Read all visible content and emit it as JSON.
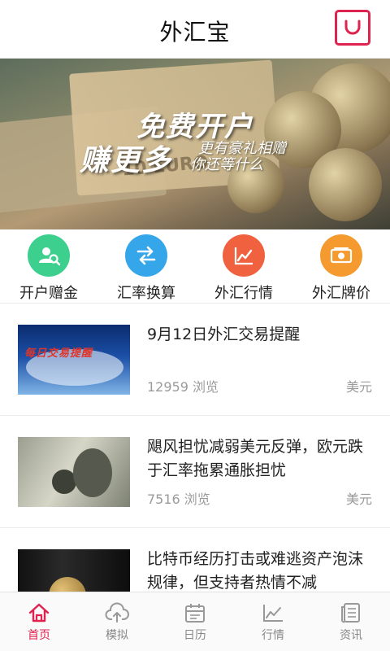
{
  "header": {
    "title": "外汇宝",
    "bag_icon": "shopping-bag-icon",
    "accent": "#e0224e"
  },
  "banner": {
    "line1": "免费开户",
    "line2": "赚更多",
    "line3": "更有豪礼相赠",
    "line4": "你还等什么",
    "bill_text": "10 EURO"
  },
  "quick_actions": [
    {
      "label": "开户赠金",
      "icon": "account-search-icon",
      "color": "#3ccf8e"
    },
    {
      "label": "汇率换算",
      "icon": "exchange-arrows-icon",
      "color": "#36a6ea"
    },
    {
      "label": "外汇行情",
      "icon": "trend-chart-icon",
      "color": "#f0623f"
    },
    {
      "label": "外汇牌价",
      "icon": "money-bill-icon",
      "color": "#f59a2e"
    }
  ],
  "news": [
    {
      "title": "9月12日外汇交易提醒",
      "views": "12959 浏览",
      "tag": "美元",
      "thumb_text": "每日交易提醒"
    },
    {
      "title": "飓风担忧减弱美元反弹，欧元跌于汇率拖累通胀担忧",
      "views": "7516 浏览",
      "tag": "美元"
    },
    {
      "title": "比特币经历打击或难逃资产泡沫规律，但支持者热情不减",
      "views": "",
      "tag": ""
    }
  ],
  "tabs": [
    {
      "label": "首页",
      "icon": "home-icon",
      "active": true
    },
    {
      "label": "模拟",
      "icon": "cloud-upload-icon",
      "active": false
    },
    {
      "label": "日历",
      "icon": "calendar-icon",
      "active": false
    },
    {
      "label": "行情",
      "icon": "line-chart-icon",
      "active": false
    },
    {
      "label": "资讯",
      "icon": "news-list-icon",
      "active": false
    }
  ]
}
